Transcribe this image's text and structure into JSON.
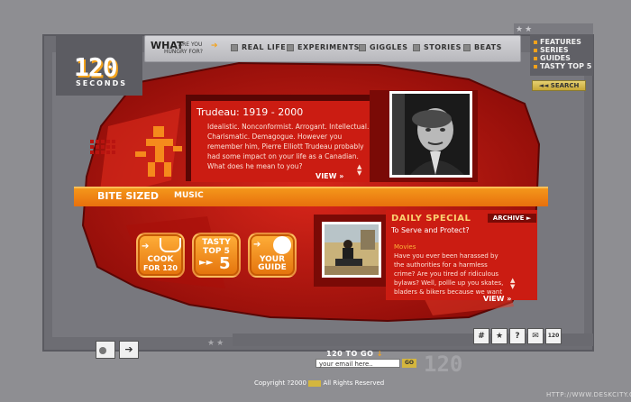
{
  "logo": {
    "number": "120",
    "subtitle": "SECONDS"
  },
  "nav": {
    "what": "WHAT",
    "are_you": "ARE YOU",
    "hungry_for": "HUNGRY FOR?",
    "items": [
      "REAL LIFE",
      "EXPERIMENTS",
      "GIGGLES",
      "STORIES",
      "BEATS"
    ]
  },
  "right_menu": {
    "items": [
      "FEATURES",
      "SERIES",
      "GUIDES",
      "TASTY TOP 5"
    ]
  },
  "search": {
    "label": "◄◄ SEARCH"
  },
  "feature": {
    "title": "Trudeau: 1919 - 2000",
    "body": "Idealistic. Nonconformist.  Arrogant. Intellectual. Charismatic. Demagogue. However you remember him, Pierre Elliott Trudeau probably had some impact on your life as a Canadian. What does he mean to you?",
    "view": "VIEW »"
  },
  "bite_sized": {
    "label": "BITE SIZED",
    "sub": "MUSIC"
  },
  "buttons": [
    {
      "line1": "COOK",
      "line2": "FOR 120"
    },
    {
      "line1": "TASTY",
      "line2": "TOP 5"
    },
    {
      "line1": "YOUR",
      "line2": "GUIDE"
    }
  ],
  "daily": {
    "heading": "DAILY SPECIAL",
    "archive": "ARCHIVE ►",
    "subtitle": "To Serve and Protect?",
    "category": "Movies",
    "body": "Have you ever been harassed by the authorities for a harmless crime? Are you tired of ridiculous bylaws? Well, pollle up you skates, bladers & bikers because we want the right to roll.",
    "view": "VIEW »"
  },
  "footer": {
    "to_go": "120 TO GO",
    "email_value": "your email here..",
    "go": "GO",
    "ghost": "120",
    "copyright": "Copyright ?2000",
    "rights": "All Rights Reserved",
    "watermark": "HTTP://WWW.DESKCITY.COM"
  },
  "icon_buttons": [
    "grid-icon",
    "star-icon",
    "help-icon",
    "mail-icon",
    "120-icon"
  ],
  "icon_120_label": "120",
  "icon_help_label": "?",
  "colors": {
    "accent": "#f3a21b",
    "red": "#cb1c12",
    "frame": "#6d6d73"
  }
}
